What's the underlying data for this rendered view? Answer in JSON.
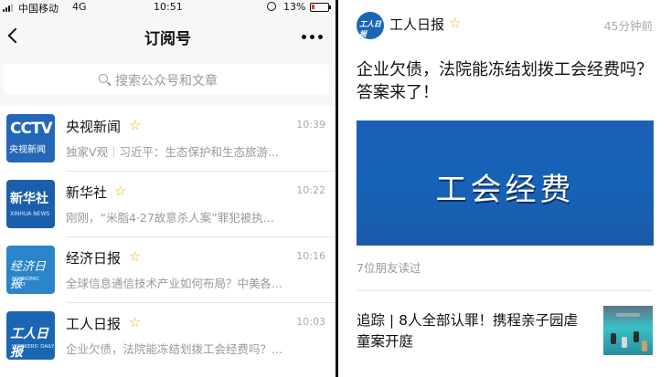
{
  "status_bar": {
    "carrier": "中国移动",
    "network": "4G",
    "time": "10:51",
    "battery": "13%"
  },
  "nav": {
    "title": "订阅号"
  },
  "search": {
    "placeholder": "搜索公众号和文章"
  },
  "subscriptions": [
    {
      "name": "央视新闻",
      "time": "10:39",
      "summary": "独家V观｜习近平：生态保护和生态旅游...",
      "avatar_text": "CCTV",
      "avatar_sub": "央视新闻"
    },
    {
      "name": "新华社",
      "time": "10:22",
      "summary": "刚刚，“米脂4·27故意杀人案”罪犯被执...",
      "avatar_text": "新华社",
      "avatar_sub": "XINHUA NEWS"
    },
    {
      "name": "经济日报",
      "time": "10:16",
      "summary": "全球信息通信技术产业如何布局？中美各...",
      "avatar_text": "经济日报",
      "avatar_sub": "ECONOMIC DAILY"
    },
    {
      "name": "工人日报",
      "time": "10:03",
      "summary": "企业欠债，法院能冻结划拨工会经费吗？...",
      "avatar_text": "工人日报",
      "avatar_sub": "WORKERS' DAILY"
    }
  ],
  "article": {
    "source": "工人日报",
    "time_ago": "45分钟前",
    "title": "企业欠债，法院能冻结划拨工会经费吗？答案来了！",
    "banner_text": "工会经费",
    "readers": "7位朋友读过",
    "related_title": "追踪 | 8人全部认罪！携程亲子园虐童案开庭",
    "avatar_text": "工人日报"
  },
  "colors": {
    "star": "#e8b400",
    "banner": "#1563b7",
    "secondary_text": "#999999"
  },
  "icons": {
    "back": "chevron-left-icon",
    "more": "more-dots-icon",
    "search": "search-icon",
    "star": "star-outline-icon"
  }
}
